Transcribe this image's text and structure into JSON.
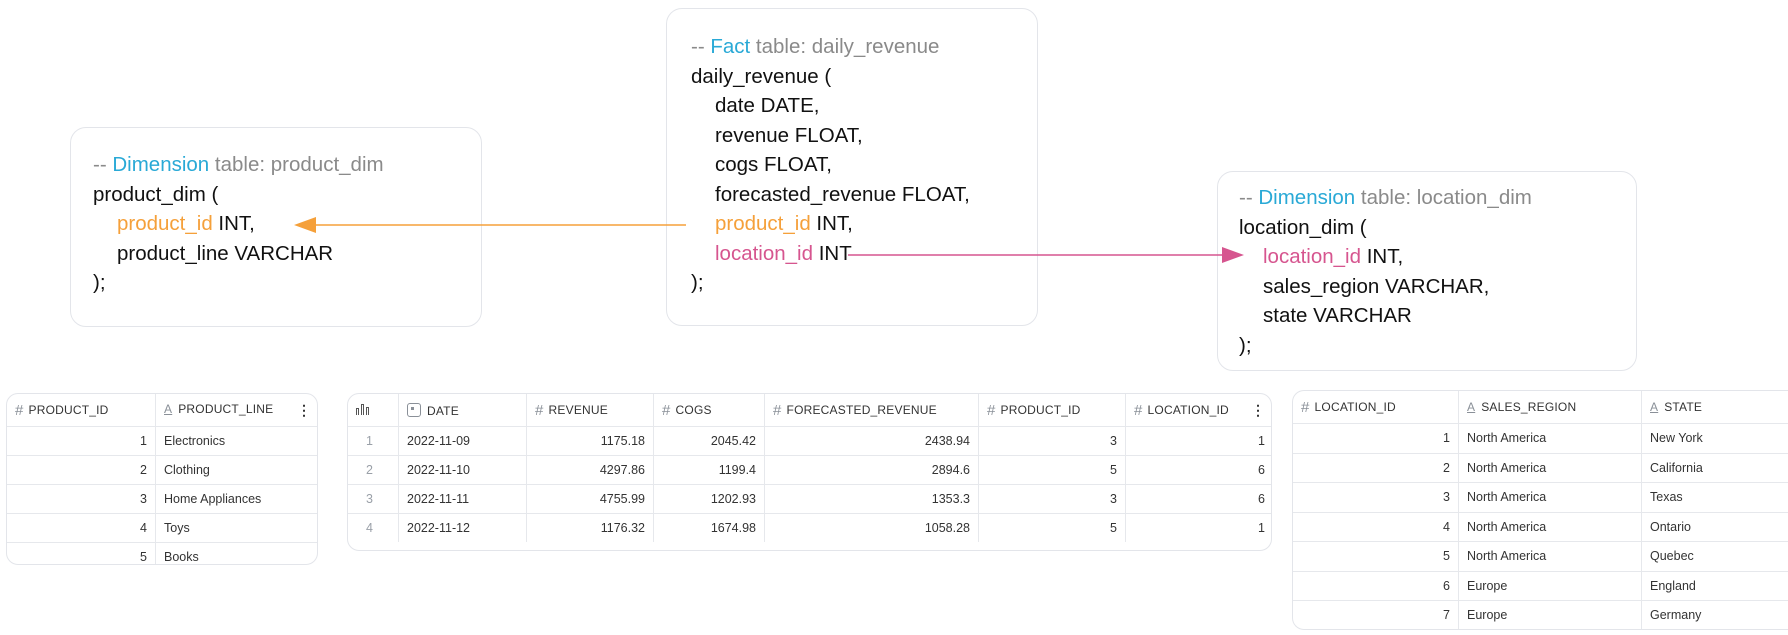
{
  "cards": {
    "product": {
      "comment_prefix": "-- ",
      "comment_kind": "Dimension",
      "comment_rest": " table: product_dim",
      "open": "product_dim (",
      "col1_name": "product_id",
      "col1_type": " INT,",
      "col2": "product_line VARCHAR",
      "close": ");"
    },
    "fact": {
      "comment_prefix": "-- ",
      "comment_kind": "Fact",
      "comment_rest": " table: daily_revenue",
      "open": "daily_revenue (",
      "col_date": "date DATE,",
      "col_revenue": "revenue FLOAT,",
      "col_cogs": "cogs FLOAT,",
      "col_forecast": "forecasted_revenue FLOAT,",
      "col_product_name": "product_id",
      "col_product_type": " INT,",
      "col_location_name": "location_id",
      "col_location_type": " INT",
      "close": ");"
    },
    "location": {
      "comment_prefix": "-- ",
      "comment_kind": "Dimension",
      "comment_rest": " table: location_dim",
      "open": "location_dim (",
      "col1_name": "location_id",
      "col1_type": " INT,",
      "col2": "sales_region VARCHAR,",
      "col3": "state VARCHAR",
      "close": ");"
    }
  },
  "colors": {
    "keyword_blue": "#29a9d6",
    "product_orange": "#f5a03a",
    "location_pink": "#d6558f",
    "comment_gray": "#8a8a8a"
  },
  "tables": {
    "product": {
      "headers": [
        "PRODUCT_ID",
        "PRODUCT_LINE"
      ],
      "rows": [
        [
          "1",
          "Electronics"
        ],
        [
          "2",
          "Clothing"
        ],
        [
          "3",
          "Home Appliances"
        ],
        [
          "4",
          "Toys"
        ],
        [
          "5",
          "Books"
        ]
      ]
    },
    "revenue": {
      "headers": [
        "DATE",
        "REVENUE",
        "COGS",
        "FORECASTED_REVENUE",
        "PRODUCT_ID",
        "LOCATION_ID"
      ],
      "rows": [
        [
          "1",
          "2022-11-09",
          "1175.18",
          "2045.42",
          "2438.94",
          "3",
          "1"
        ],
        [
          "2",
          "2022-11-10",
          "4297.86",
          "1199.4",
          "2894.6",
          "5",
          "6"
        ],
        [
          "3",
          "2022-11-11",
          "4755.99",
          "1202.93",
          "1353.3",
          "3",
          "6"
        ],
        [
          "4",
          "2022-11-12",
          "1176.32",
          "1674.98",
          "1058.28",
          "5",
          "1"
        ]
      ]
    },
    "location": {
      "headers": [
        "LOCATION_ID",
        "SALES_REGION",
        "STATE"
      ],
      "rows": [
        [
          "1",
          "North America",
          "New York"
        ],
        [
          "2",
          "North America",
          "California"
        ],
        [
          "3",
          "North America",
          "Texas"
        ],
        [
          "4",
          "North America",
          "Ontario"
        ],
        [
          "5",
          "North America",
          "Quebec"
        ],
        [
          "6",
          "Europe",
          "England"
        ],
        [
          "7",
          "Europe",
          "Germany"
        ]
      ]
    }
  },
  "icons": {
    "number_column": "hash-icon",
    "text_column": "text-a-icon",
    "date_column": "calendar-icon",
    "row_index": "bar-chart-icon",
    "menu": "kebab-menu-icon"
  }
}
